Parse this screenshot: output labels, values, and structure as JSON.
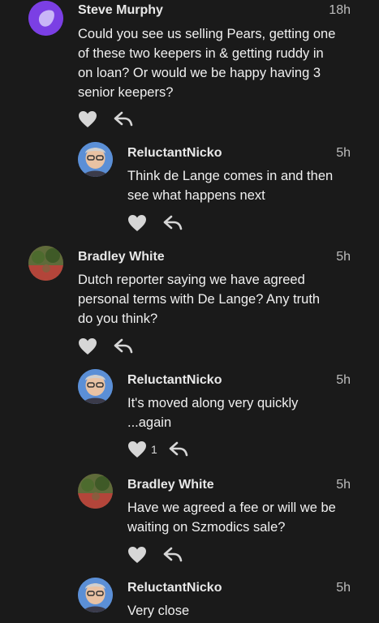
{
  "colors": {
    "background": "#1a1a1a",
    "text": "#f0f0f0",
    "meta": "#bdbdbd",
    "icon": "#d6d6d6",
    "avatar_purple": "#7b3fe4"
  },
  "comments": [
    {
      "author": "Steve Murphy",
      "time": "18h",
      "text": "Could you see us selling Pears, getting one\nof these two keepers in & getting ruddy in\non loan? Or would we be happy having 3\nsenior keepers?",
      "likes": null
    },
    {
      "author": "ReluctantNicko",
      "time": "5h",
      "text": "Think de Lange comes in and then\nsee what happens next",
      "likes": null
    },
    {
      "author": "Bradley White",
      "time": "5h",
      "text": "Dutch reporter saying we have agreed\npersonal terms with De Lange? Any truth\ndo you think?",
      "likes": null
    },
    {
      "author": "ReluctantNicko",
      "time": "5h",
      "text": "It's moved along very quickly\n...again",
      "likes": "1"
    },
    {
      "author": "Bradley White",
      "time": "5h",
      "text": "Have we agreed a fee or will we be\nwaiting on Szmodics sale?",
      "likes": null
    },
    {
      "author": "ReluctantNicko",
      "time": "5h",
      "text": "Very close",
      "likes": null
    }
  ]
}
